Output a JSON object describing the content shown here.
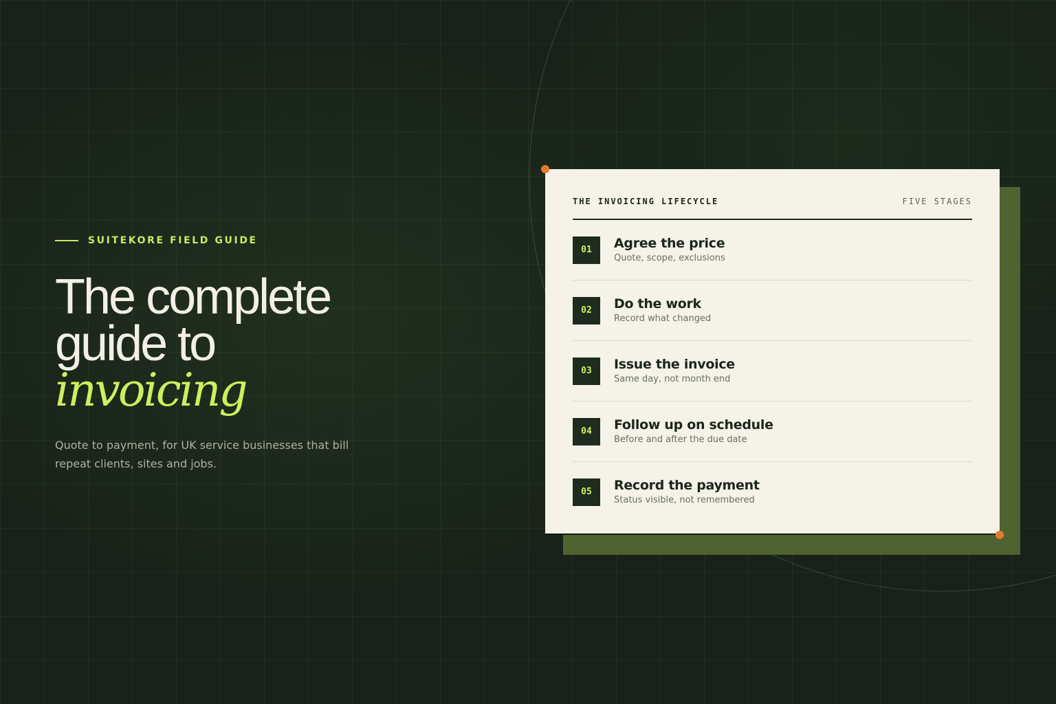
{
  "hero": {
    "eyebrow": "SUITEKORE FIELD GUIDE",
    "title_line1": "The complete",
    "title_line2": "guide to",
    "title_accent": "invoicing",
    "subtitle": "Quote to payment, for UK service businesses that bill repeat clients, sites and jobs."
  },
  "card": {
    "title": "THE INVOICING LIFECYCLE",
    "count_label": "FIVE STAGES",
    "stages": [
      {
        "num": "01",
        "title": "Agree the price",
        "desc": "Quote, scope, exclusions"
      },
      {
        "num": "02",
        "title": "Do the work",
        "desc": "Record what changed"
      },
      {
        "num": "03",
        "title": "Issue the invoice",
        "desc": "Same day, not month end"
      },
      {
        "num": "04",
        "title": "Follow up on schedule",
        "desc": "Before and after the due date"
      },
      {
        "num": "05",
        "title": "Record the payment",
        "desc": "Status visible, not remembered"
      }
    ]
  },
  "colors": {
    "background": "#18221a",
    "accent_lime": "#cdef5e",
    "accent_orange": "#e57a2e",
    "card_bg": "#f5f2e8",
    "card_shadow": "#4e6330",
    "badge_bg": "#1e2b1e"
  }
}
